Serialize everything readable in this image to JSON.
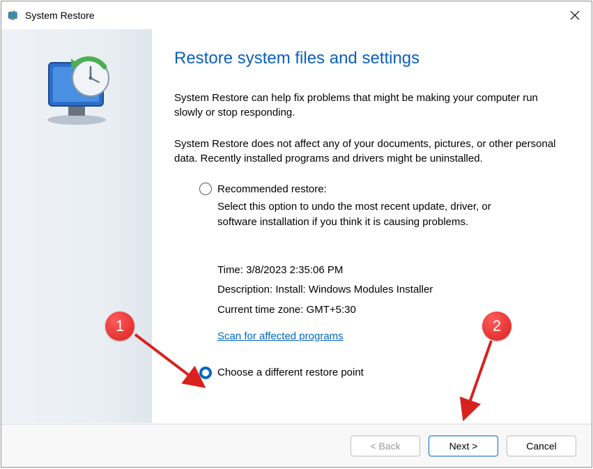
{
  "window": {
    "title": "System Restore"
  },
  "main": {
    "heading": "Restore system files and settings",
    "para1": "System Restore can help fix problems that might be making your computer run slowly or stop responding.",
    "para2": "System Restore does not affect any of your documents, pictures, or other personal data. Recently installed programs and drivers might be uninstalled.",
    "recommended": {
      "label": "Recommended restore:",
      "desc": "Select this option to undo the most recent update, driver, or software installation if you think it is causing problems.",
      "time": "Time: 3/8/2023 2:35:06 PM",
      "description_line": "Description: Install: Windows Modules Installer",
      "timezone": "Current time zone: GMT+5:30",
      "scan_link": "Scan for affected programs"
    },
    "different_label": "Choose a different restore point"
  },
  "footer": {
    "back": "< Back",
    "next": "Next >",
    "cancel": "Cancel"
  },
  "annotations": {
    "badge1": "1",
    "badge2": "2"
  }
}
